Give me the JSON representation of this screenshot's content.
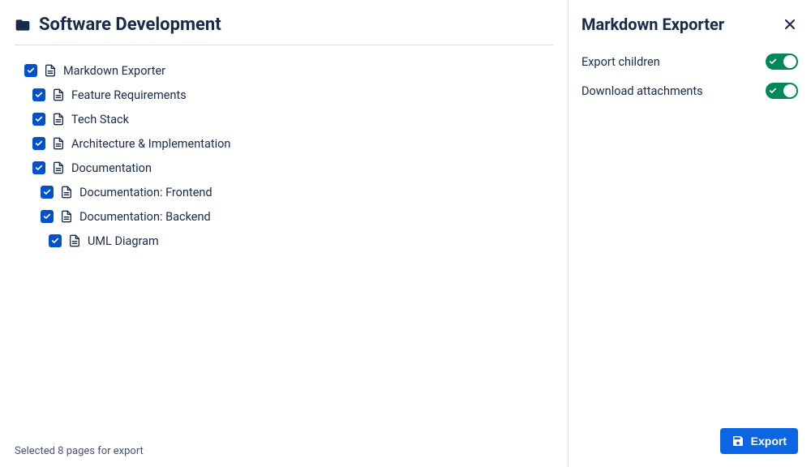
{
  "main": {
    "title": "Software Development",
    "selected_text": "Selected 8 pages for export"
  },
  "tree": [
    {
      "label": "Markdown Exporter",
      "level": 1,
      "checked": true
    },
    {
      "label": "Feature Requirements",
      "level": 2,
      "checked": true
    },
    {
      "label": "Tech Stack",
      "level": 2,
      "checked": true
    },
    {
      "label": "Architecture & Implementation",
      "level": 2,
      "checked": true
    },
    {
      "label": "Documentation",
      "level": 2,
      "checked": true
    },
    {
      "label": "Documentation: Frontend",
      "level": 3,
      "checked": true
    },
    {
      "label": "Documentation: Backend",
      "level": 3,
      "checked": true
    },
    {
      "label": "UML Diagram",
      "level": 4,
      "checked": true
    }
  ],
  "side": {
    "title": "Markdown Exporter",
    "options": {
      "export_children": {
        "label": "Export children",
        "on": true
      },
      "download_attachments": {
        "label": "Download attachments",
        "on": true
      }
    },
    "export_label": "Export"
  },
  "colors": {
    "primary_blue": "#0C66E4",
    "checkbox_blue": "#0052CC",
    "toggle_green": "#00875A",
    "text": "#172B4D"
  }
}
